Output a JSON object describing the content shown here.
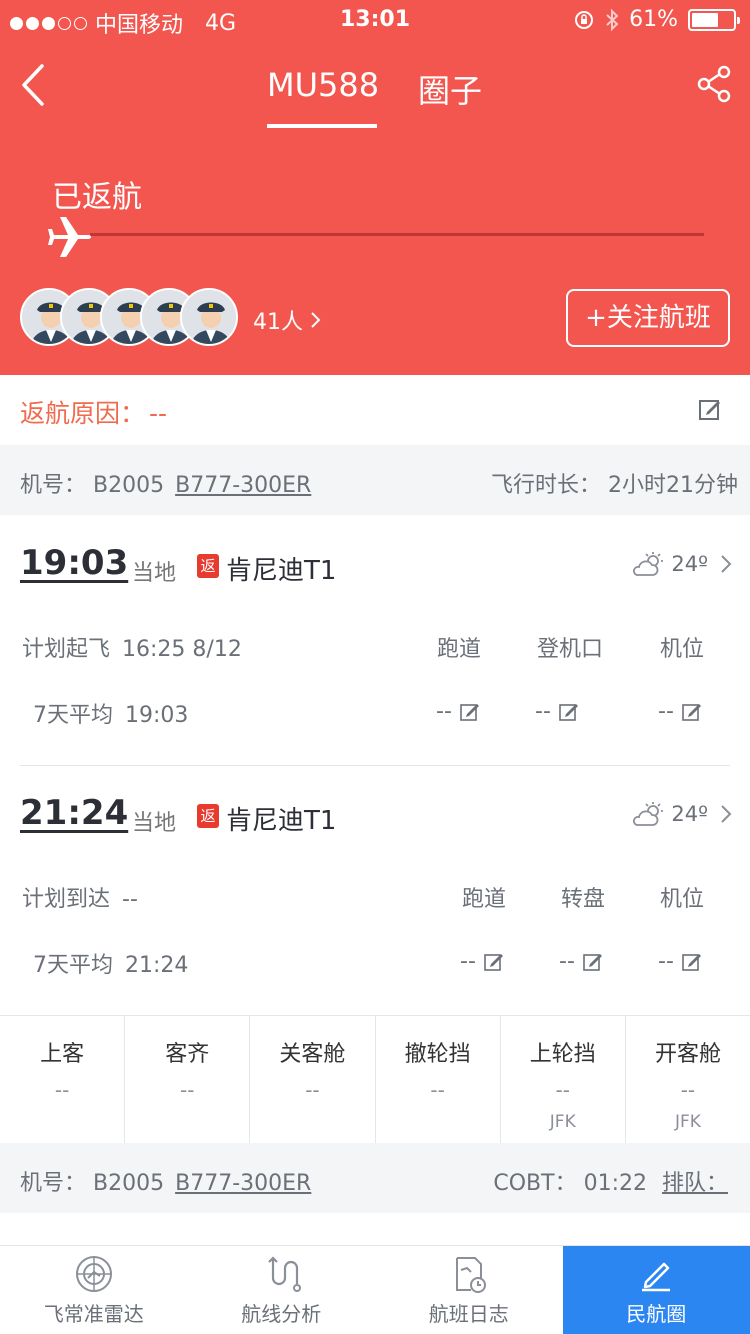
{
  "status_bar": {
    "carrier": "中国移动",
    "network": "4G",
    "time": "13:01",
    "battery": "61%"
  },
  "nav": {
    "tabs": [
      "MU588",
      "圈子"
    ],
    "active_tab": "MU588"
  },
  "flight_status": "已返航",
  "social": {
    "followers": "41人",
    "follow_button": "+关注航班"
  },
  "return_reason": {
    "label": "返航原因：",
    "value": "--"
  },
  "plane_info_top": {
    "label": "机号：",
    "number": "B2005",
    "model": "B777-300ER",
    "duration_label": "飞行时长：",
    "duration": "2小时21分钟"
  },
  "departure": {
    "time": "19:03",
    "local": "当地",
    "badge": "返",
    "airport": "肯尼迪T1",
    "temperature": "24º",
    "plan_label": "计划起飞",
    "plan_value": "16:25 8/12",
    "avg_label": "7天平均",
    "avg_value": "19:03",
    "columns": [
      {
        "label": "跑道",
        "value": "--"
      },
      {
        "label": "登机口",
        "value": "--"
      },
      {
        "label": "机位",
        "value": "--"
      }
    ]
  },
  "arrival": {
    "time": "21:24",
    "local": "当地",
    "badge": "返",
    "airport": "肯尼迪T1",
    "temperature": "24º",
    "plan_label": "计划到达",
    "plan_value": "--",
    "avg_label": "7天平均",
    "avg_value": "21:24",
    "columns": [
      {
        "label": "跑道",
        "value": "--"
      },
      {
        "label": "转盘",
        "value": "--"
      },
      {
        "label": "机位",
        "value": "--"
      }
    ]
  },
  "events": [
    {
      "label": "上客",
      "value": "--",
      "sub": ""
    },
    {
      "label": "客齐",
      "value": "--",
      "sub": ""
    },
    {
      "label": "关客舱",
      "value": "--",
      "sub": ""
    },
    {
      "label": "撤轮挡",
      "value": "--",
      "sub": ""
    },
    {
      "label": "上轮挡",
      "value": "--",
      "sub": "JFK"
    },
    {
      "label": "开客舱",
      "value": "--",
      "sub": "JFK"
    }
  ],
  "plane_info_bottom": {
    "label": "机号：",
    "number": "B2005",
    "model": "B777-300ER",
    "cobt_label": "COBT：",
    "cobt": "01:22",
    "queue": "排队："
  },
  "tabbar": [
    {
      "label": "飞常准雷达",
      "icon": "radar-icon"
    },
    {
      "label": "航线分析",
      "icon": "route-icon"
    },
    {
      "label": "航班日志",
      "icon": "log-icon"
    },
    {
      "label": "民航圈",
      "icon": "pen-icon"
    }
  ],
  "colors": {
    "header": "#f2564f",
    "reason": "#f06a4e",
    "badge": "#e83a2e",
    "active_tab": "#2b86f2"
  }
}
